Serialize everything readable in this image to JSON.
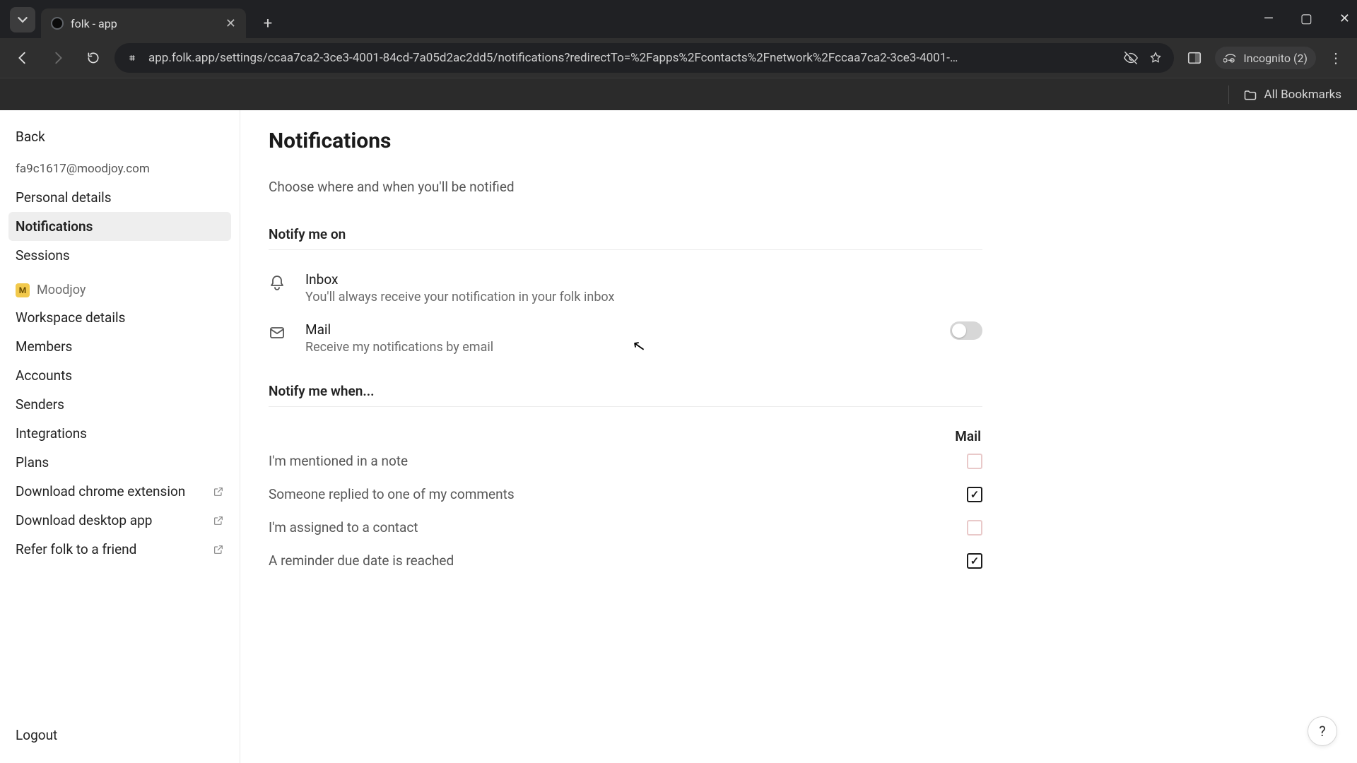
{
  "browser": {
    "tab_title": "folk - app",
    "url": "app.folk.app/settings/ccaa7ca2-3ce3-4001-84cd-7a05d2ac2dd5/notifications?redirectTo=%2Fapps%2Fcontacts%2Fnetwork%2Fccaa7ca2-3ce3-4001-…",
    "incognito_label": "Incognito (2)",
    "bookmarks_label": "All Bookmarks"
  },
  "sidebar": {
    "back": "Back",
    "email": "fa9c1617@moodjoy.com",
    "items_user": [
      "Personal details",
      "Notifications",
      "Sessions"
    ],
    "selected_user_index": 1,
    "workspace_name": "Moodjoy",
    "items_ws": [
      "Workspace details",
      "Members",
      "Accounts",
      "Senders",
      "Integrations",
      "Plans"
    ],
    "items_ext": [
      "Download chrome extension",
      "Download desktop app",
      "Refer folk to a friend"
    ],
    "logout": "Logout"
  },
  "page": {
    "title": "Notifications",
    "subtitle": "Choose where and when you'll be notified",
    "notify_on_label": "Notify me on",
    "channels": [
      {
        "key": "inbox",
        "title": "Inbox",
        "desc": "You'll always receive your notification in your folk inbox",
        "toggle": null
      },
      {
        "key": "mail",
        "title": "Mail",
        "desc": "Receive my notifications by email",
        "toggle": false
      }
    ],
    "notify_when_label": "Notify me when...",
    "when_column": "Mail",
    "when_rows": [
      {
        "label": "I'm mentioned in a note",
        "mail_checked": false,
        "disabled": true
      },
      {
        "label": "Someone replied to one of my comments",
        "mail_checked": true,
        "disabled": false
      },
      {
        "label": "I'm assigned to a contact",
        "mail_checked": false,
        "disabled": true
      },
      {
        "label": "A reminder due date is reached",
        "mail_checked": true,
        "disabled": false
      }
    ]
  },
  "colors": {
    "sidebar_selected_bg": "#eeeeee",
    "accent": "#2563eb"
  }
}
